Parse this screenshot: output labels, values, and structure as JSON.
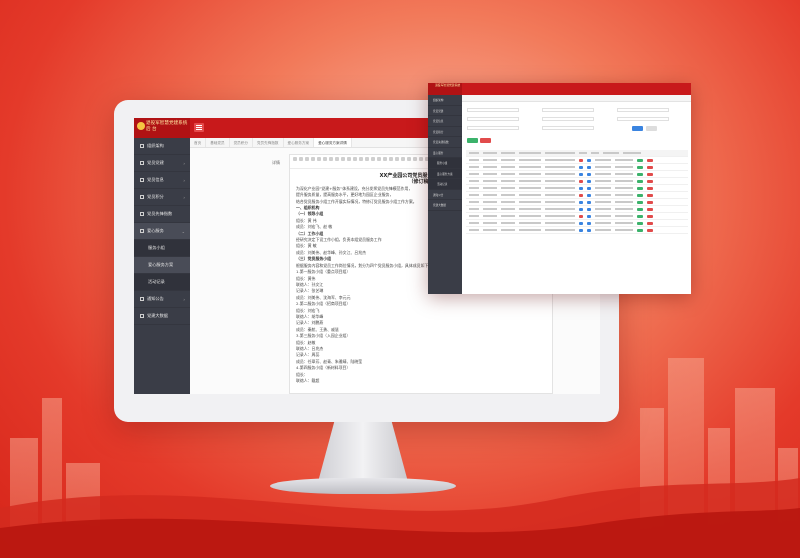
{
  "main_app": {
    "logo_title": "退役军智慧党建系统",
    "logo_sub": "后 台",
    "sidebar": [
      "组织架构",
      "党员党建",
      "党员信息",
      "党员积分",
      "党员先锋指数",
      "爱心服务",
      "服务小组",
      "爱心服务方案",
      "活动记录",
      "通知公告",
      "党建大数据"
    ],
    "tabs": [
      "首页",
      "基础党员",
      "党员积分",
      "党员先锋指数",
      "爱心服务方案",
      "爱心服务方案详情"
    ],
    "form_label": "详情",
    "doc": {
      "title": "XX产业园公司党员服务小组工作方案",
      "subtitle": "（修订稿）",
      "lines": [
        "为深化产业园“党建+服务”体系建设，充分发挥党员先锋模范作用，",
        "提升服务质量，提高服务水平，更好地为园区企业服务，",
        "结合党员服务小组工作开展实际情况，特修订党员服务小组工作方案。",
        "一、组织机构",
        "（一）领导小组",
        "组长：黄 伟",
        "成员：刘宏飞、赵 敏",
        "（二）工作小组",
        "经研究决定下设工作小组，负责本组党员服务工作",
        "组长：黄 敏",
        "成员：刘美伟、赵华峰、孙文江、吕兆杰",
        "（三）党员服务小组",
        "根据服务内容和党员工作岗位情况，划分为四个党员服务小组，具体成员如下：",
        "1.第一服务小组（重点项目组）",
        "组长：黄伟",
        "联络人：孙文江",
        "记录人：张艺琳",
        "成员：刘美伟、沈海军、李元元",
        "2.第二服务小组（招商项目组）",
        "组长：刘宏飞",
        "联络人：胡华峰",
        "记录人：刘鹏燕",
        "成员：秦航、王勇、戚慧",
        "3.第三服务小组（入园企业组）",
        "组长：赵敏",
        "联络人：吕兆杰",
        "记录人：周蕊",
        "成员：任翠芳、赵青、朱雅晴、陆晓莹",
        "4.第四服务小组（新材料项目）",
        "组长：",
        "联络人：戴超"
      ]
    }
  },
  "float_app": {
    "logo_title": "退役军智慧党建系统",
    "sidebar": [
      "组织架构",
      "党员党建",
      "党员信息",
      "党员积分",
      "党员先锋指数",
      "爱心服务",
      "服务小组",
      "爱心服务方案",
      "活动记录",
      "通知公告",
      "党建大数据"
    ]
  },
  "colors": {
    "accent": "#c8191b",
    "sidebar": "#3a3d47",
    "green": "#3bb26b",
    "red": "#e14b4b",
    "blue": "#3a84e0"
  }
}
